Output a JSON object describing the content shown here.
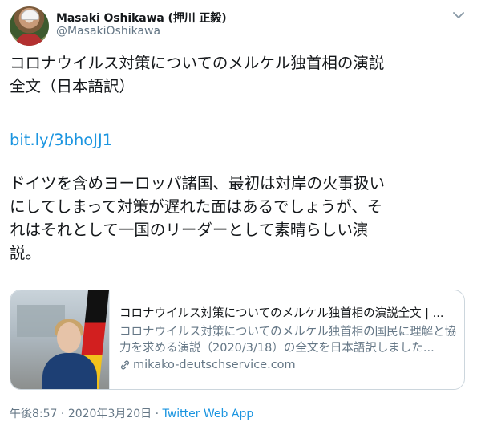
{
  "user": {
    "name": "Masaki Oshikawa (押川 正毅)",
    "handle": "@MasakiOshikawa"
  },
  "tweet": {
    "text_line1": "コロナウイルス対策についてのメルケル独首相の演説\n全文（日本語訳）",
    "link": "bit.ly/3bhoJJ1",
    "text_line2": "ドイツを含めヨーロッパ諸国、最初は対岸の火事扱い\nにしてしまって対策が遅れた面はあるでしょうが、そ\nれはそれとして一国のリーダーとして素晴らしい演\n説。"
  },
  "card": {
    "title": "コロナウイルス対策についてのメルケル独首相の演説全文 | ...",
    "description": "コロナウイルス対策についてのメルケル独首相の国民に理解と協力を求める演説（2020/3/18）の全文を日本語訳しました...",
    "domain": "mikako-deutschservice.com"
  },
  "meta": {
    "time": "午後8:57",
    "separator": " · ",
    "date": "2020年3月20日",
    "source": "Twitter Web App"
  },
  "colors": {
    "link": "#1b95e0",
    "secondary_text": "#657786",
    "border": "#ccd6dd"
  },
  "icons": {
    "caret": "chevron-down-icon",
    "domain_link": "link-icon"
  }
}
